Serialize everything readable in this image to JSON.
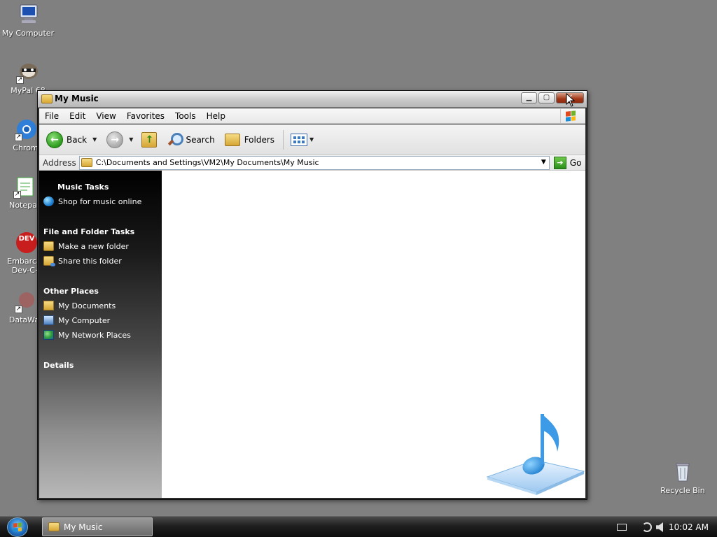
{
  "desktop": {
    "icons": [
      {
        "label": "My Computer",
        "icon": "my-computer-icon"
      },
      {
        "label": "MyPal 68",
        "icon": "mypal-icon"
      },
      {
        "label": "Chromi",
        "icon": "chromium-icon"
      },
      {
        "label": "Notepac",
        "icon": "notepad-icon"
      },
      {
        "label": "Embarcad",
        "label2": "Dev-C+",
        "badge": "DEV",
        "icon": "devcpp-icon"
      },
      {
        "label": "DataWag",
        "icon": "datawag-icon"
      },
      {
        "label": "Recycle Bin",
        "icon": "recycle-bin-icon"
      }
    ]
  },
  "window": {
    "title": "My Music",
    "controls": {
      "minimize": "minimize-button",
      "maximize": "maximize-button",
      "close": "close-button"
    }
  },
  "menubar": {
    "items": [
      "File",
      "Edit",
      "View",
      "Favorites",
      "Tools",
      "Help"
    ]
  },
  "toolbar": {
    "back_label": "Back",
    "search_label": "Search",
    "folders_label": "Folders"
  },
  "address": {
    "label": "Address",
    "path": "C:\\Documents and Settings\\VM2\\My Documents\\My Music",
    "go_label": "Go"
  },
  "taskpane": {
    "music_tasks": {
      "title": "Music Tasks",
      "links": [
        "Shop for music online"
      ]
    },
    "file_folder_tasks": {
      "title": "File and Folder Tasks",
      "links": [
        "Make a new folder",
        "Share this folder"
      ]
    },
    "other_places": {
      "title": "Other Places",
      "links": [
        "My Documents",
        "My Computer",
        "My Network Places"
      ]
    },
    "details": {
      "title": "Details"
    }
  },
  "taskbar": {
    "task_label": "My Music",
    "clock": "10:02 AM"
  },
  "colors": {
    "desktop": "#808080",
    "taskpane_top": "#000000",
    "accent_close": "#a33818"
  }
}
